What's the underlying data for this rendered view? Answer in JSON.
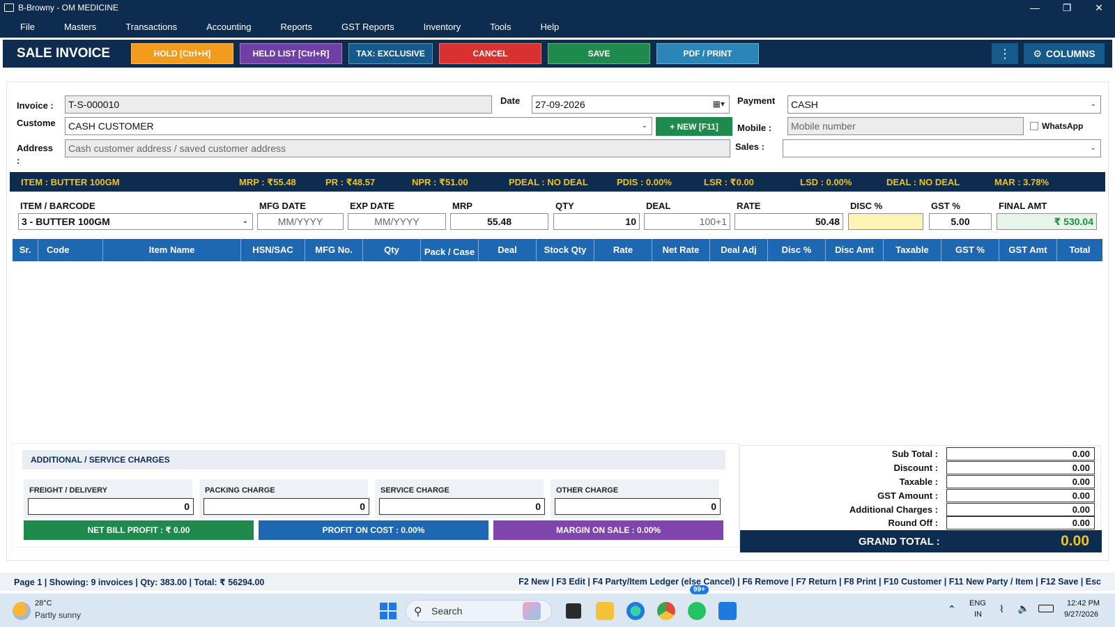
{
  "window": {
    "title": "B-Browny - OM MEDICINE"
  },
  "menu": [
    "File",
    "Masters",
    "Transactions",
    "Accounting",
    "Reports",
    "GST Reports",
    "Inventory",
    "Tools",
    "Help"
  ],
  "toolbar": {
    "title": "SALE INVOICE",
    "hold": "HOLD [Ctrl+H]",
    "held_list": "HELD LIST [Ctrl+R]",
    "tax": "TAX: EXCLUSIVE",
    "cancel": "CANCEL",
    "save": "SAVE",
    "pdf": "PDF / PRINT",
    "kebab": "⋮",
    "columns": "COLUMNS",
    "colors": {
      "hold": "#f39c1c",
      "held_list": "#6f3fa6",
      "tax": "#155a8a",
      "cancel": "#d9312f",
      "save": "#1e8a4c",
      "pdf": "#2a86b8"
    }
  },
  "form": {
    "invoice_label": "Invoice :",
    "invoice_value": "T-S-000010",
    "date_label": "Date",
    "date_value": "27-09-2026",
    "payment_label": "Payment",
    "payment_value": "CASH",
    "customer_label": "Custome",
    "customer_value": "CASH CUSTOMER",
    "new_button": "+ NEW [F11]",
    "mobile_label": "Mobile :",
    "mobile_placeholder": "Mobile number",
    "whatsapp_label": "WhatsApp",
    "address_label": "Address",
    "address_label_2": ":",
    "address_placeholder": "Cash customer address / saved customer address",
    "sales_label": "Sales :",
    "sales_value": ""
  },
  "info": {
    "item": "ITEM : BUTTER 100GM",
    "mrp": "MRP : ₹55.48",
    "pr": "PR : ₹48.57",
    "npr": "NPR : ₹51.00",
    "pdeal": "PDEAL : NO DEAL",
    "pdis": "PDIS : 0.00%",
    "lsr": "LSR : ₹0.00",
    "lsd": "LSD : 0.00%",
    "deal": "DEAL : NO DEAL",
    "mar": "MAR : 3.78%"
  },
  "entry": {
    "item_label": "ITEM / BARCODE",
    "item_value": "3 - BUTTER 100GM",
    "mfg_label": "MFG DATE",
    "mfg_placeholder": "MM/YYYY",
    "exp_label": "EXP DATE",
    "exp_placeholder": "MM/YYYY",
    "mrp_label": "MRP",
    "mrp_value": "55.48",
    "qty_label": "QTY",
    "qty_value": "10",
    "deal_label": "DEAL",
    "deal_placeholder": "100+1",
    "rate_label": "RATE",
    "rate_value": "50.48",
    "disc_label": "DISC %",
    "disc_value": "",
    "gst_label": "GST %",
    "gst_value": "5.00",
    "final_label": "FINAL AMT",
    "final_value": "₹ 530.04"
  },
  "table": {
    "columns": [
      "Sr.",
      "Code",
      "Item Name",
      "HSN/SAC",
      "MFG No.",
      "Qty",
      "Pack / Case",
      "Deal",
      "Stock Qty",
      "Rate",
      "Net Rate",
      "Deal Adj",
      "Disc %",
      "Disc Amt",
      "Taxable",
      "GST %",
      "GST Amt",
      "Total"
    ],
    "rows": []
  },
  "additional": {
    "heading": "ADDITIONAL / SERVICE CHARGES",
    "charges": [
      {
        "label": "FREIGHT / DELIVERY",
        "value": "0"
      },
      {
        "label": "PACKING CHARGE",
        "value": "0"
      },
      {
        "label": "SERVICE CHARGE",
        "value": "0"
      },
      {
        "label": "OTHER CHARGE",
        "value": "0"
      }
    ],
    "net_profit": "NET BILL PROFIT : ₹ 0.00",
    "profit_on_cost": "PROFIT ON COST : 0.00%",
    "margin_on_sale": "MARGIN ON SALE : 0.00%"
  },
  "totals": {
    "rows": [
      {
        "label": "Sub Total :",
        "value": "0.00"
      },
      {
        "label": "Discount :",
        "value": "0.00"
      },
      {
        "label": "Taxable :",
        "value": "0.00"
      },
      {
        "label": "GST Amount :",
        "value": "0.00"
      },
      {
        "label": "Additional Charges :",
        "value": "0.00"
      },
      {
        "label": "Round Off :",
        "value": "0.00"
      }
    ],
    "grand_label": "GRAND TOTAL :",
    "grand_value": "0.00"
  },
  "status": {
    "left": "Page 1  |  Showing: 9 invoices  |  Qty: 383.00  |  Total: ₹ 56294.00",
    "right": "F2 New | F3 Edit | F4 Party/Item Ledger (else Cancel) | F6 Remove | F7 Return | F8 Print | F10 Customer | F11 New Party / Item | F12 Save | Esc"
  },
  "taskbar": {
    "weather_temp": "28°C",
    "weather_desc": "Partly sunny",
    "search": "Search",
    "badge": "99+",
    "lang_1": "ENG",
    "lang_2": "IN",
    "time": "12:42 PM",
    "date": "9/27/2026"
  }
}
